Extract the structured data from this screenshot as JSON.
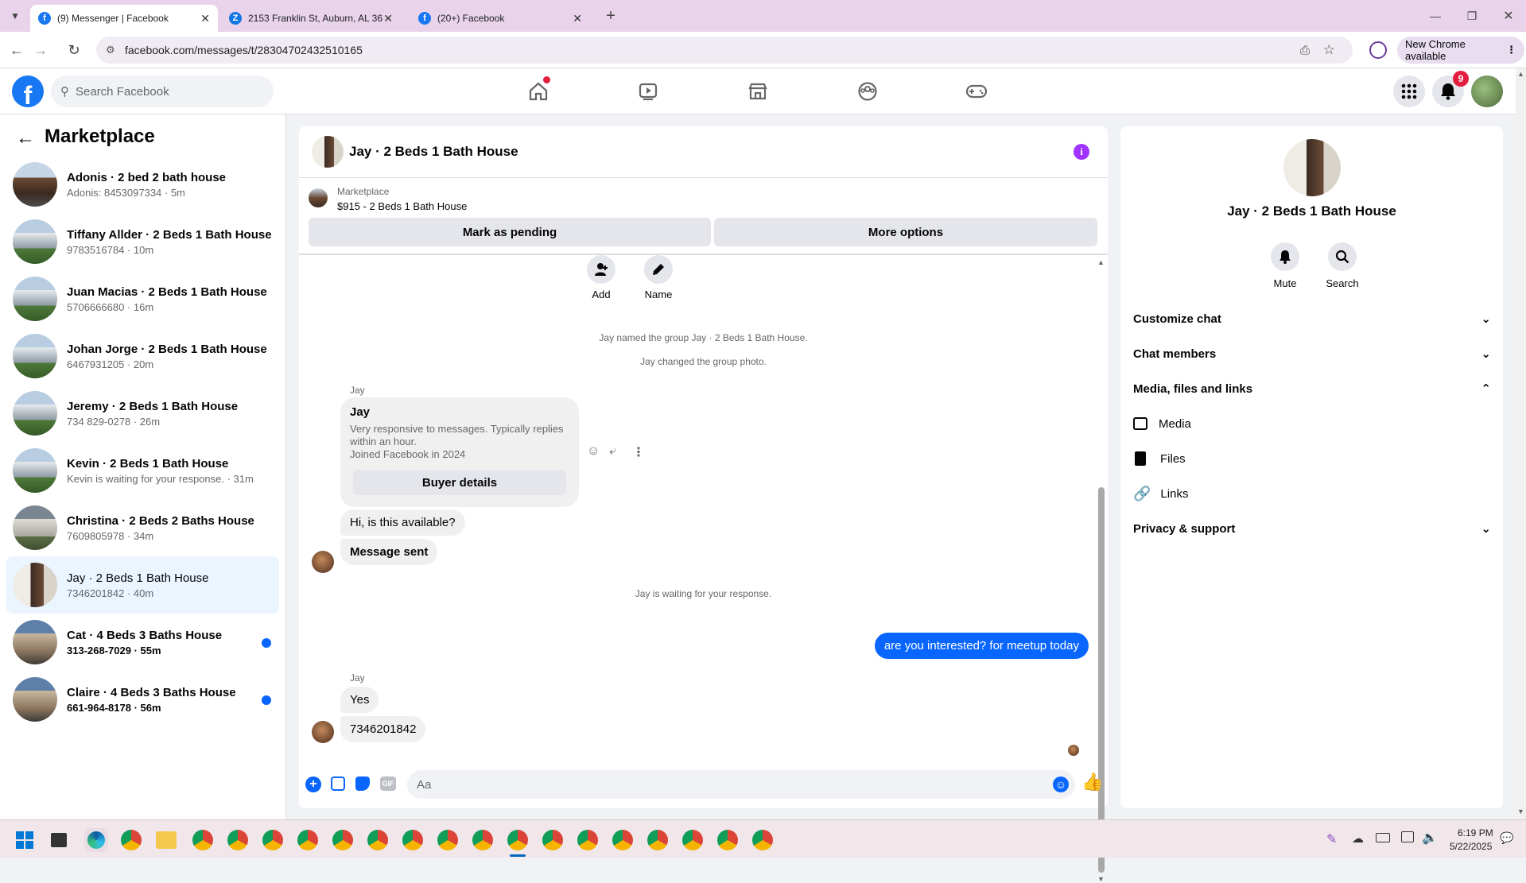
{
  "browser": {
    "tabs": [
      {
        "title": "(9) Messenger | Facebook",
        "active": true
      },
      {
        "title": "2153 Franklin St, Auburn, AL 36",
        "active": false
      },
      {
        "title": "(20+) Facebook",
        "active": false
      }
    ],
    "url": "facebook.com/messages/t/28304702432510165",
    "new_chrome_label": "New Chrome available"
  },
  "header": {
    "search_placeholder": "Search Facebook",
    "notification_count": "9"
  },
  "sidebar": {
    "title": "Marketplace",
    "conversations": [
      {
        "name": "Adonis · 2 bed 2 bath house",
        "sub": "Adonis: 8453097334 · 5m",
        "unread": false,
        "selected": false
      },
      {
        "name": "Tiffany Allder · 2 Beds 1 Bath House",
        "sub": "9783516784 · 10m",
        "unread": false,
        "selected": false
      },
      {
        "name": "Juan Macias · 2 Beds 1 Bath House",
        "sub": "5706666680 · 16m",
        "unread": false,
        "selected": false
      },
      {
        "name": "Johan Jorge · 2 Beds 1 Bath House",
        "sub": "6467931205 · 20m",
        "unread": false,
        "selected": false
      },
      {
        "name": "Jeremy · 2 Beds 1 Bath House",
        "sub": "734 829-0278 · 26m",
        "unread": false,
        "selected": false
      },
      {
        "name": "Kevin · 2 Beds 1 Bath House",
        "sub": "Kevin is waiting for your response. · 31m",
        "unread": false,
        "selected": false
      },
      {
        "name": "Christina · 2 Beds 2 Baths House",
        "sub": "7609805978 · 34m",
        "unread": false,
        "selected": false
      },
      {
        "name": "Jay · 2 Beds 1 Bath House",
        "sub": "7346201842 · 40m",
        "unread": false,
        "selected": true
      },
      {
        "name": "Cat · 4 Beds 3 Baths House",
        "sub": "313-268-7029 · 55m",
        "unread": true,
        "selected": false
      },
      {
        "name": "Claire · 4 Beds 3 Baths House",
        "sub": "661-964-8178 · 56m",
        "unread": true,
        "selected": false
      }
    ]
  },
  "chat": {
    "title": "Jay · 2 Beds 1 Bath House",
    "listing_label": "Marketplace",
    "listing_text": "$915 - 2 Beds 1 Bath House",
    "mark_pending": "Mark as pending",
    "more_options": "More options",
    "add_label": "Add",
    "name_label": "Name",
    "sys1": "Jay named the group Jay · 2 Beds 1 Bath House.",
    "sys2": "Jay changed the group photo.",
    "sender1": "Jay",
    "card_name": "Jay",
    "card_desc1": "Very responsive to messages. Typically replies",
    "card_desc2": "within an hour.",
    "card_joined": "Joined Facebook in 2024",
    "buyer_details": "Buyer details",
    "msg1": "Hi, is this available?",
    "msg2": "Message sent",
    "sys3": "Jay is waiting for your response.",
    "my_msg": "are you interested? for meetup today",
    "sender2": "Jay",
    "msg3": "Yes",
    "msg4": "7346201842",
    "composer_placeholder": "Aa"
  },
  "info": {
    "title": "Jay · 2 Beds 1 Bath House",
    "mute": "Mute",
    "search": "Search",
    "customize": "Customize chat",
    "members": "Chat members",
    "media_files": "Media, files and links",
    "media": "Media",
    "files": "Files",
    "links": "Links",
    "privacy": "Privacy & support"
  },
  "taskbar": {
    "time": "6:19 PM",
    "date": "5/22/2025"
  }
}
